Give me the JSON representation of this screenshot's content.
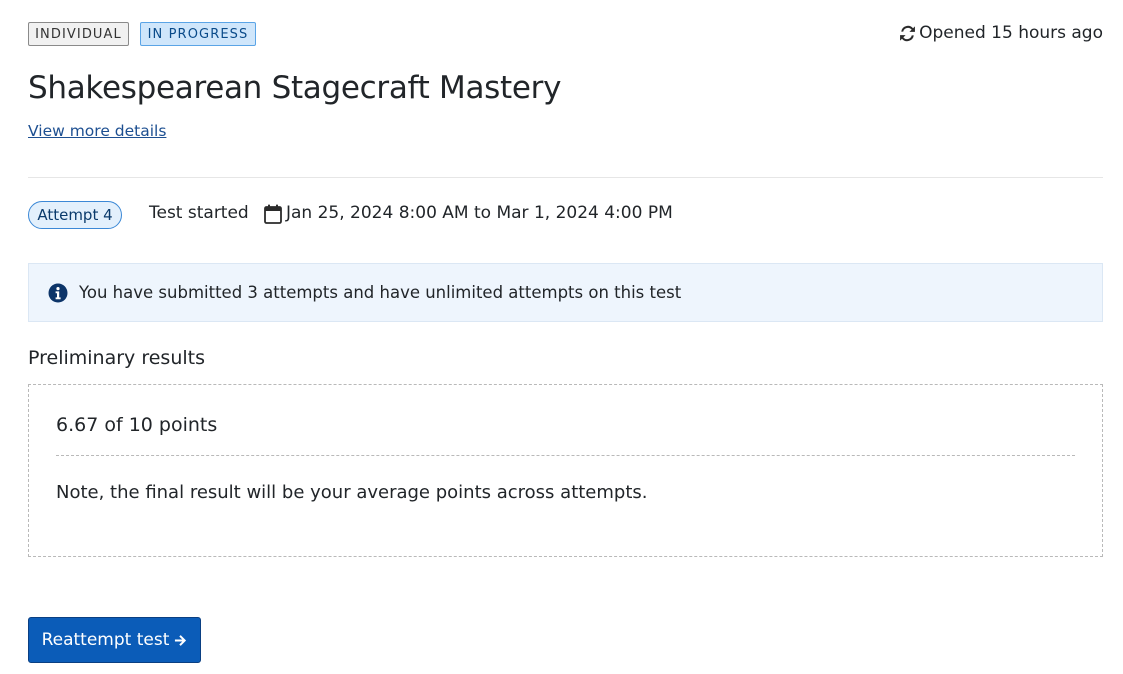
{
  "header": {
    "tags": {
      "individual": "INDIVIDUAL",
      "status": "IN PROGRESS"
    },
    "opened_text": "Opened 15 hours ago",
    "opened_icon": "refresh-icon",
    "title": "Shakespearean Stagecraft Mastery",
    "details_link": "View more details"
  },
  "attempt": {
    "label": "Attempt 4",
    "started_label": "Test started",
    "calendar_icon": "calendar-icon",
    "date_range": "Jan 25, 2024 8:00 AM to Mar 1, 2024 4:00 PM"
  },
  "info_banner": {
    "icon": "info-circle-icon",
    "text": "You have submitted 3 attempts and have unlimited attempts on this test"
  },
  "results": {
    "heading": "Preliminary results",
    "points_text": "6.67 of 10 points",
    "note": "Note, the final result will be your average points across attempts."
  },
  "actions": {
    "reattempt_label": "Reattempt test",
    "reattempt_icon": "arrow-right-icon"
  },
  "colors": {
    "accent": "#0b5cb8",
    "status_badge_bg": "#cfe6fb",
    "info_banner_bg": "#eef5fd",
    "link": "#1d4f91"
  }
}
